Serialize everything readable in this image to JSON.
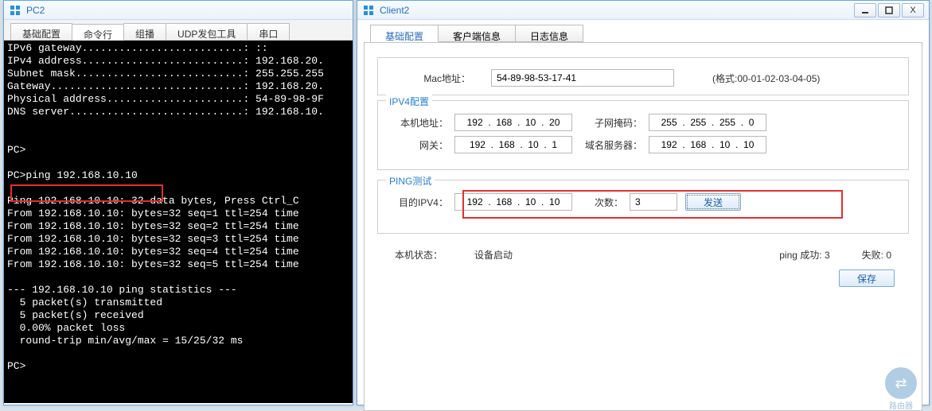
{
  "pc2": {
    "title": "PC2",
    "tabs": [
      "基础配置",
      "命令行",
      "组播",
      "UDP发包工具",
      "串口"
    ],
    "active_tab": 1,
    "terminal_lines": [
      "IPv6 gateway..........................: ::",
      "IPv4 address..........................: 192.168.20.",
      "Subnet mask...........................: 255.255.255",
      "Gateway...............................: 192.168.20.",
      "Physical address......................: 54-89-98-9F",
      "DNS server............................: 192.168.10.",
      "",
      "",
      "PC>",
      "",
      "PC>ping 192.168.10.10",
      "",
      "Ping 192.168.10.10: 32 data bytes, Press Ctrl_C",
      "From 192.168.10.10: bytes=32 seq=1 ttl=254 time",
      "From 192.168.10.10: bytes=32 seq=2 ttl=254 time",
      "From 192.168.10.10: bytes=32 seq=3 ttl=254 time",
      "From 192.168.10.10: bytes=32 seq=4 ttl=254 time",
      "From 192.168.10.10: bytes=32 seq=5 ttl=254 time",
      "",
      "--- 192.168.10.10 ping statistics ---",
      "  5 packet(s) transmitted",
      "  5 packet(s) received",
      "  0.00% packet loss",
      "  round-trip min/avg/max = 15/25/32 ms",
      "",
      "PC>"
    ]
  },
  "client2": {
    "title": "Client2",
    "tabs": [
      "基础配置",
      "客户端信息",
      "日志信息"
    ],
    "active_tab": 0,
    "mac": {
      "label": "Mac地址：",
      "value": "54-89-98-53-17-41",
      "hint": "(格式:00-01-02-03-04-05)"
    },
    "ipv4": {
      "legend": "IPV4配置",
      "local_label": "本机地址：",
      "local_value": "192  .  168  .  10  .  20",
      "mask_label": "子网掩码：",
      "mask_value": "255  .  255  .  255  .  0",
      "gw_label": "网关：",
      "gw_value": "192  .  168  .  10  .  1",
      "dns_label": "域名服务器：",
      "dns_value": "192  .  168  .  10  .  10"
    },
    "ping": {
      "legend": "PING测试",
      "target_label": "目的IPV4：",
      "target_value": "192  .  168  .  10  .  10",
      "count_label": "次数：",
      "count_value": "3",
      "send_label": "发送"
    },
    "status": {
      "machine_label": "本机状态：",
      "machine_value": "设备启动",
      "ping_ok_label": "ping 成功:",
      "ping_ok_value": "3",
      "fail_label": "失败:",
      "fail_value": "0"
    },
    "save_label": "保存"
  },
  "watermark": {
    "brand": "路由器"
  }
}
